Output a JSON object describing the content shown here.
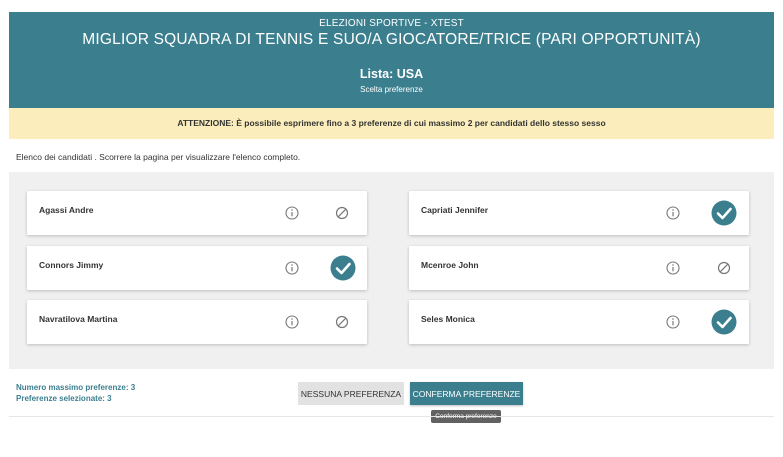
{
  "header": {
    "subtitle": "ELEZIONI SPORTIVE - XTEST",
    "title": "MIGLIOR SQUADRA DI TENNIS E SUO/A GIOCATORE/TRICE (PARI OPPORTUNITÀ)",
    "list": "Lista: USA",
    "scelta": "Scelta preferenze"
  },
  "warning": "ATTENZIONE: È possibile esprimere fino a 3 preferenze di cui massimo 2 per candidati dello stesso sesso",
  "intro": "Elenco dei candidati . Scorrere la pagina per visualizzare l'elenco completo.",
  "candidates": [
    {
      "name": "Agassi Andre",
      "selected": false,
      "info_icon": "info-icon",
      "choice_icon": "ban-icon"
    },
    {
      "name": "Capriati Jennifer",
      "selected": true,
      "info_icon": "info-icon",
      "choice_icon": "check-circle-icon"
    },
    {
      "name": "Connors Jimmy",
      "selected": true,
      "info_icon": "info-icon",
      "choice_icon": "check-circle-icon"
    },
    {
      "name": "Mcenroe John",
      "selected": false,
      "info_icon": "info-icon",
      "choice_icon": "ban-icon"
    },
    {
      "name": "Navratilova Martina",
      "selected": false,
      "info_icon": "info-icon",
      "choice_icon": "ban-icon"
    },
    {
      "name": "Seles Monica",
      "selected": true,
      "info_icon": "info-icon",
      "choice_icon": "check-circle-icon"
    }
  ],
  "footer": {
    "max_label": "Numero massimo preferenze: 3",
    "selected_label": "Preferenze selezionate: 3"
  },
  "buttons": {
    "none": "NESSUNA PREFERENZA",
    "confirm": "CONFERMA PREFERENZE"
  },
  "tooltip": "Conferma preferenze",
  "colors": {
    "accent": "#3b7f8f",
    "warning_bg": "#fbeebc",
    "panel_bg": "#f0f0f0"
  }
}
